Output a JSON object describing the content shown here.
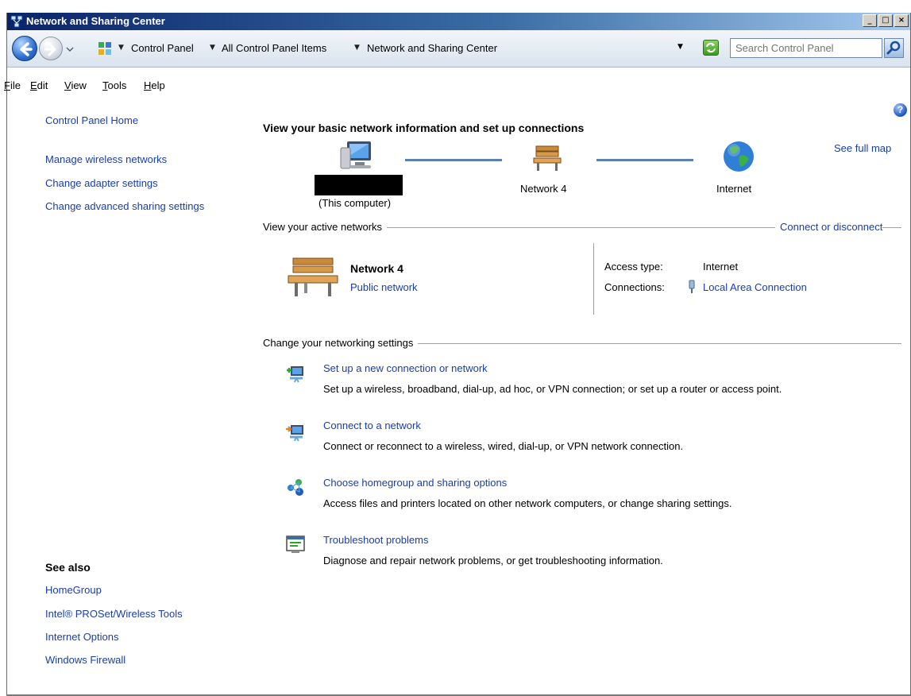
{
  "window": {
    "title": "Network and Sharing Center",
    "buttons": {
      "minimize": "_",
      "maximize": "□",
      "close": "×"
    }
  },
  "address_bar": {
    "breadcrumbs": [
      "Control Panel",
      "All Control Panel Items",
      "Network and Sharing Center"
    ],
    "search_placeholder": "Search Control Panel"
  },
  "menu": {
    "items": [
      {
        "key": "F",
        "rest": "ile"
      },
      {
        "key": "E",
        "rest": "dit"
      },
      {
        "key": "V",
        "rest": "iew"
      },
      {
        "key": "T",
        "rest": "ools"
      },
      {
        "key": "H",
        "rest": "elp"
      }
    ]
  },
  "sidebar": {
    "home": "Control Panel Home",
    "links": [
      "Manage wireless networks",
      "Change adapter settings",
      "Change advanced sharing settings"
    ],
    "see_also_title": "See also",
    "see_also": [
      "HomeGroup",
      "Intel® PROSet/Wireless Tools",
      "Internet Options",
      "Windows Firewall"
    ]
  },
  "main": {
    "heading": "View your basic network information and set up connections",
    "see_full_map": "See full map",
    "map": {
      "computer_label": "(This computer)",
      "network_label": "Network  4",
      "internet_label": "Internet"
    },
    "active_networks": {
      "title": "View your active networks",
      "connect_link": "Connect or disconnect",
      "network_name": "Network  4",
      "network_type": "Public network",
      "access_type_label": "Access type:",
      "access_type_value": "Internet",
      "connections_label": "Connections:",
      "connections_value": "Local Area Connection"
    },
    "change_settings": {
      "title": "Change your networking settings",
      "tasks": [
        {
          "link": "Set up a new connection or network",
          "desc": "Set up a wireless, broadband, dial-up, ad hoc, or VPN connection; or set up a router or access point.",
          "icon": "new-connection-icon"
        },
        {
          "link": "Connect to a network",
          "desc": "Connect or reconnect to a wireless, wired, dial-up, or VPN network connection.",
          "icon": "connect-network-icon"
        },
        {
          "link": "Choose homegroup and sharing options",
          "desc": "Access files and printers located on other network computers, or change sharing settings.",
          "icon": "homegroup-icon"
        },
        {
          "link": "Troubleshoot problems",
          "desc": "Diagnose and repair network problems, or get troubleshooting information.",
          "icon": "troubleshoot-icon"
        }
      ]
    }
  },
  "colors": {
    "link": "#1a3ea8",
    "map_line": "#5b7fb2",
    "title_bar_start": "#0a246a"
  }
}
